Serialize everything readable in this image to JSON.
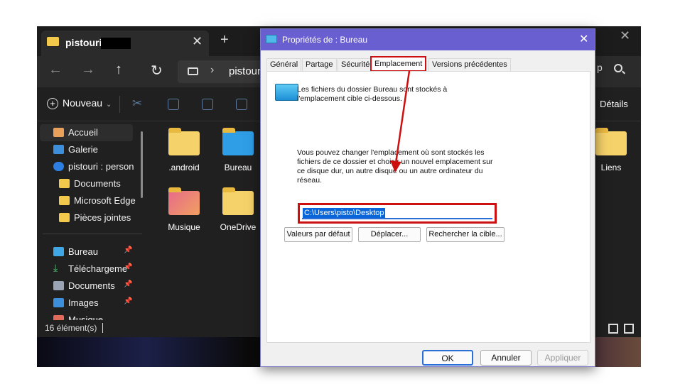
{
  "explorer": {
    "tab_title": "pistouri",
    "address": "pistour",
    "search_tail": "p",
    "new_label": "Nouveau",
    "details_label": "Détails",
    "sidebar": [
      {
        "label": "Accueil",
        "icon": "home-icon"
      },
      {
        "label": "Galerie",
        "icon": "gallery-icon"
      },
      {
        "label": "pistouri : personn",
        "icon": "onedrive-icon"
      },
      {
        "label": "Documents",
        "icon": "folder-icon"
      },
      {
        "label": "Microsoft Edge",
        "icon": "folder-icon"
      },
      {
        "label": "Pièces jointes",
        "icon": "folder-icon"
      },
      {
        "label": "Bureau",
        "icon": "desktop-icon"
      },
      {
        "label": "Téléchargements",
        "icon": "download-icon"
      },
      {
        "label": "Documents",
        "icon": "documents-icon"
      },
      {
        "label": "Images",
        "icon": "images-icon"
      },
      {
        "label": "Musique",
        "icon": "music-icon"
      }
    ],
    "items": [
      ".android",
      "Bureau",
      "Musique",
      "OneDrive",
      "Liens"
    ],
    "status": "16 élément(s)"
  },
  "dialog": {
    "title": "Propriétés de : Bureau",
    "tabs": [
      "Général",
      "Partage",
      "Sécurité",
      "Emplacement",
      "Versions précédentes"
    ],
    "selected_tab": "Emplacement",
    "intro_line1": "Les fichiers du dossier Bureau sont stockés à",
    "intro_line2": "l'emplacement cible ci-dessous.",
    "info_line1": "Vous pouvez changer l'emplacement où sont stockés les",
    "info_line2": "fichiers de ce dossier et choisir un nouvel emplacement sur",
    "info_line3": "ce disque dur, un autre disque ou un autre ordinateur du",
    "info_line4": "réseau.",
    "path": "C:\\Users\\pisto\\Desktop",
    "restore_label": "Valeurs par défaut",
    "move_label": "Déplacer...",
    "find_label": "Rechercher la cible...",
    "ok_label": "OK",
    "cancel_label": "Annuler",
    "apply_label": "Appliquer"
  },
  "colors": {
    "highlight": "#cc1010",
    "title_bar": "#6a5fd0",
    "selection": "#0a65d9"
  }
}
